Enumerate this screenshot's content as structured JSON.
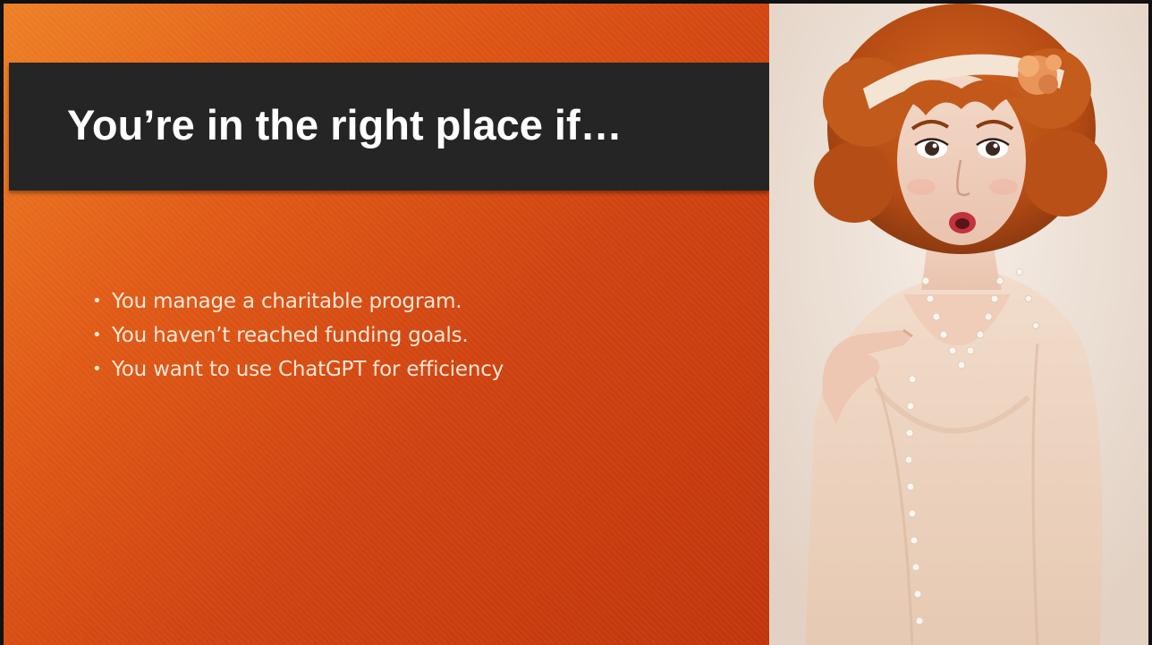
{
  "slide": {
    "title": "You’re in the right place if…",
    "bullets": [
      "You manage a charitable program.",
      "You haven’t reached funding goals.",
      "You want to use ChatGPT for efficiency"
    ],
    "bullet_symbol": "•"
  },
  "colors": {
    "background_gradient_start": "#ee8025",
    "background_gradient_end": "#c0350c",
    "title_bar": "#252525",
    "title_text": "#ffffff",
    "bullet_text": "#fde7d6"
  },
  "photo": {
    "icon": "surprised-woman-photo"
  }
}
